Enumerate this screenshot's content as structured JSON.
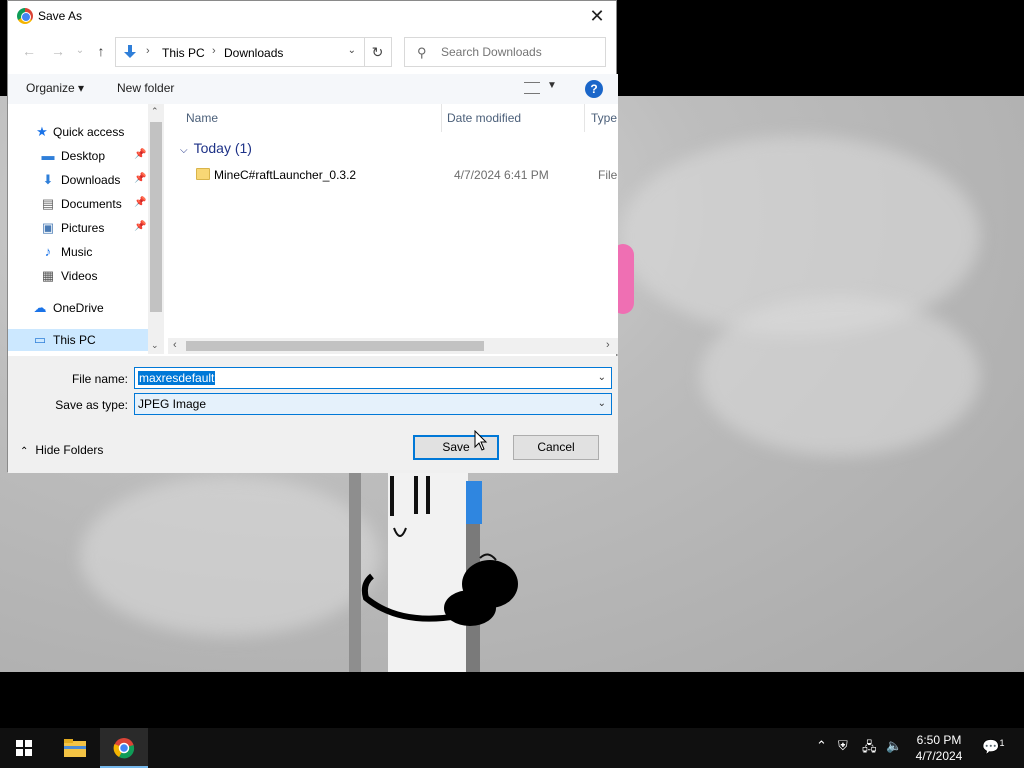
{
  "dialog": {
    "title": "Save As",
    "close_glyph": "✕",
    "nav": {
      "back_glyph": "←",
      "forward_glyph": "→",
      "recent_glyph": "⌄",
      "up_glyph": "↑",
      "breadcrumbs": [
        "This PC",
        "Downloads"
      ],
      "crumb_sep": "›",
      "dropdown_glyph": "⌄",
      "refresh_glyph": "↻",
      "search_placeholder": "Search Downloads"
    },
    "toolbar": {
      "organize_label": "Organize ▾",
      "new_folder_label": "New folder",
      "view_dd_glyph": "▼",
      "help_glyph": "?"
    },
    "nav_pane": [
      {
        "label": "Quick access",
        "icon": "star-icon",
        "glyph": "★",
        "color": "#1a73e8"
      },
      {
        "label": "Desktop",
        "icon": "desktop-icon",
        "glyph": "▬",
        "color": "#2f7fd9",
        "pinned": true
      },
      {
        "label": "Downloads",
        "icon": "download-icon",
        "glyph": "⬇",
        "color": "#2f7fd9",
        "pinned": true
      },
      {
        "label": "Documents",
        "icon": "document-icon",
        "glyph": "▤",
        "color": "#666",
        "pinned": true
      },
      {
        "label": "Pictures",
        "icon": "pictures-icon",
        "glyph": "▣",
        "color": "#4a7bb5",
        "pinned": true
      },
      {
        "label": "Music",
        "icon": "music-icon",
        "glyph": "♪",
        "color": "#1a73e8"
      },
      {
        "label": "Videos",
        "icon": "videos-icon",
        "glyph": "▦",
        "color": "#555"
      },
      {
        "label": "OneDrive",
        "icon": "cloud-icon",
        "glyph": "☁",
        "color": "#1a73e8"
      },
      {
        "label": "This PC",
        "icon": "pc-icon",
        "glyph": "▭",
        "color": "#2f7fd9",
        "selected": true
      }
    ],
    "pin_glyph": "📌",
    "columns": [
      "Name",
      "Date modified",
      "Type"
    ],
    "group_label": "Today (1)",
    "group_chevron": "⌵",
    "files": [
      {
        "name": "MineC#raftLauncher_0.3.2",
        "date": "4/7/2024 6:41 PM",
        "type": "File fo"
      }
    ],
    "scroll_up": "⌃",
    "scroll_down": "⌄",
    "scroll_left": "‹",
    "scroll_right": "›",
    "form": {
      "file_name_label": "File name:",
      "file_name_value": "maxresdefault",
      "save_type_label": "Save as type:",
      "save_type_value": "JPEG Image",
      "dd_glyph": "⌄"
    },
    "buttons": {
      "save": "Save",
      "cancel": "Cancel"
    },
    "hide_folders_label": "Hide Folders",
    "hide_folders_chevron": "⌃"
  },
  "taskbar": {
    "time": "6:50 PM",
    "date": "4/7/2024",
    "tray_chevron": "⌃",
    "notif_glyph": "💬",
    "notif_count": "1"
  },
  "colors": {
    "accent": "#0078d7",
    "selection": "#cce8ff"
  }
}
